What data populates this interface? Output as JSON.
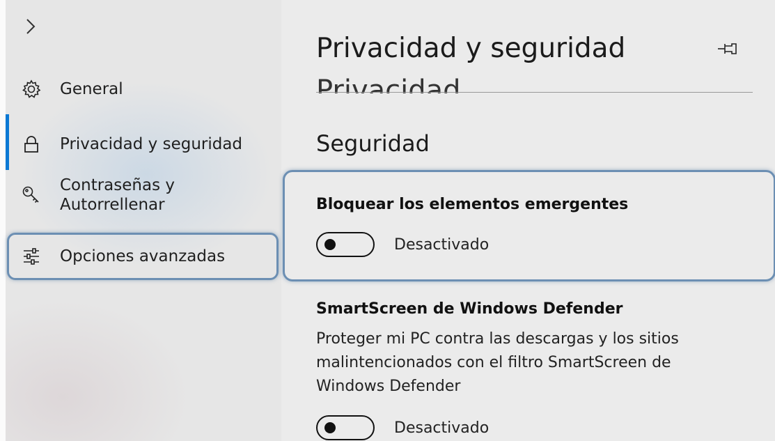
{
  "sidebar": {
    "items": [
      {
        "label": "General",
        "icon": "gear-icon"
      },
      {
        "label": "Privacidad y seguridad",
        "icon": "lock-icon"
      },
      {
        "label": "Contraseñas y Autorrellenar",
        "line1": "Contraseñas y",
        "line2": "Autorrellenar",
        "icon": "key-icon"
      },
      {
        "label": "Opciones avanzadas",
        "icon": "sliders-icon"
      }
    ],
    "accent_color": "#0a78d4"
  },
  "panel": {
    "title": "Privacidad y seguridad",
    "clipped_heading": "Privacidad",
    "section_title": "Seguridad",
    "settings": [
      {
        "title": "Bloquear los elementos emergentes",
        "toggle_state": "Desactivado"
      },
      {
        "title": "SmartScreen de Windows Defender",
        "description": "Proteger mi PC contra las descargas y los sitios malintencionados con el filtro SmartScreen de Windows Defender",
        "toggle_state": "Desactivado"
      }
    ]
  },
  "highlight_color": "#6c8fb3"
}
